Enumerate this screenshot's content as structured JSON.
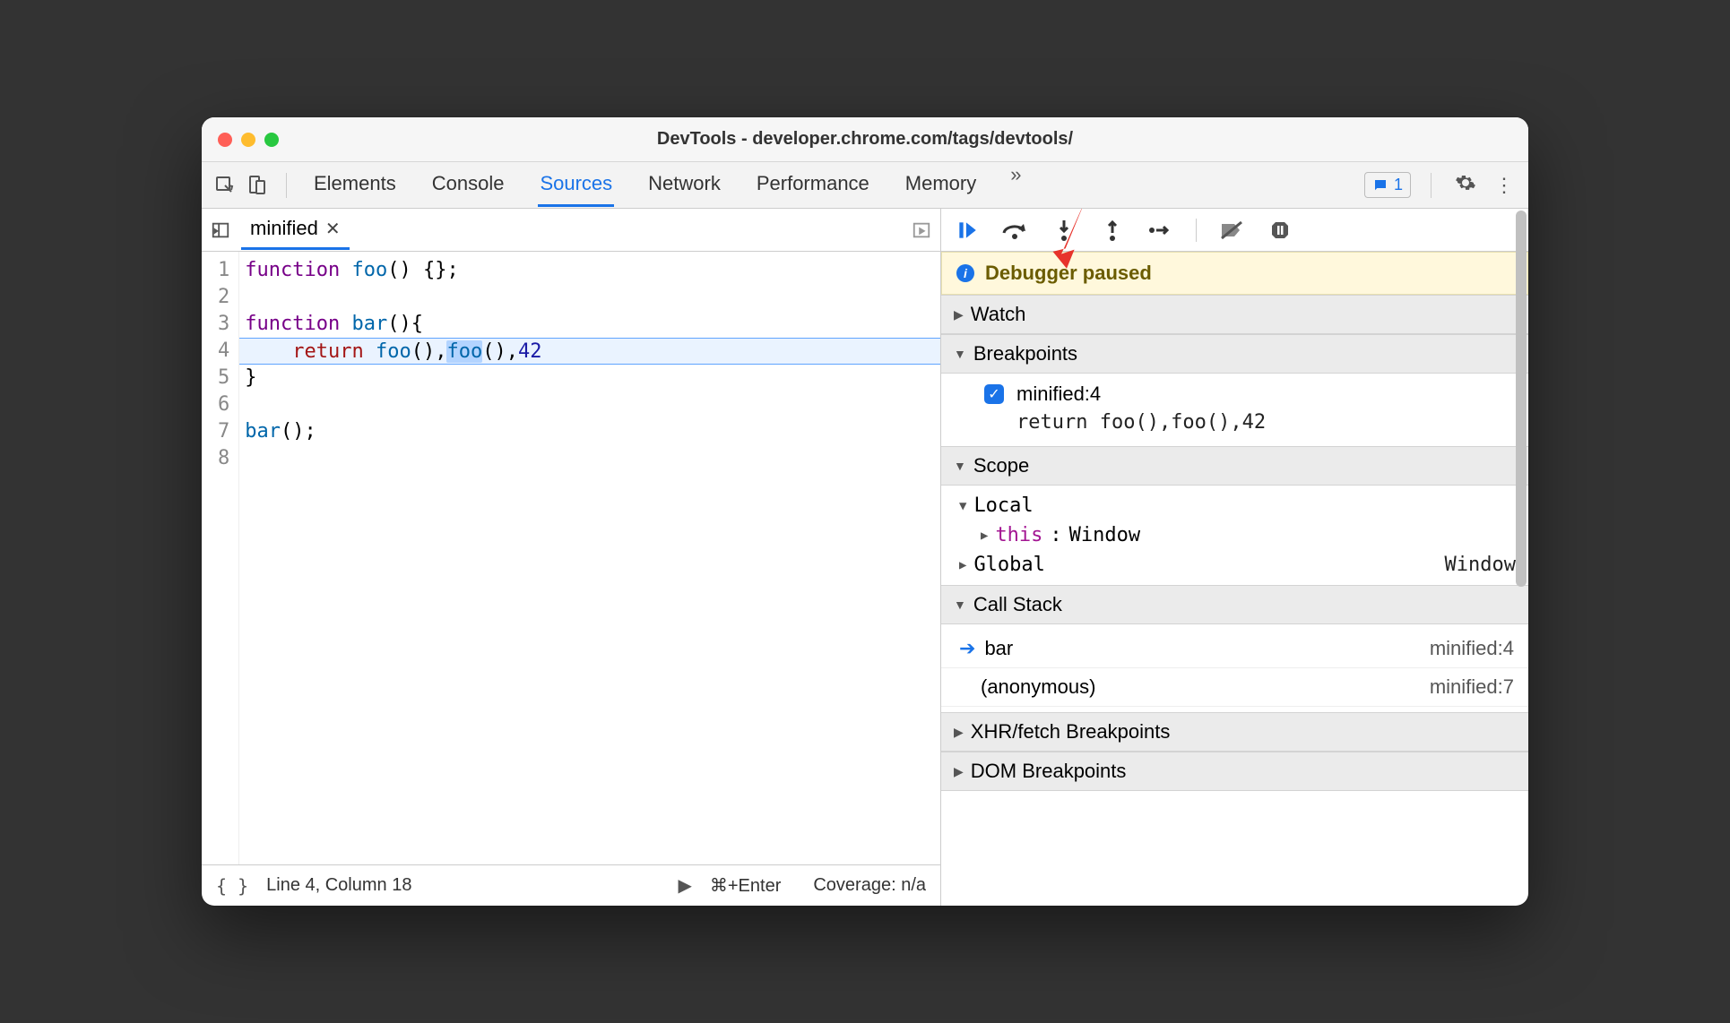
{
  "window": {
    "title": "DevTools - developer.chrome.com/tags/devtools/"
  },
  "messages": {
    "count": "1"
  },
  "tabs": {
    "items": [
      "Elements",
      "Console",
      "Sources",
      "Network",
      "Performance",
      "Memory"
    ],
    "active_index": 2
  },
  "file_tab": {
    "name": "minified"
  },
  "editor": {
    "lines": [
      "function foo() {};",
      "",
      "function bar(){",
      "    return foo(),foo(),42",
      "}",
      "",
      "bar();",
      ""
    ],
    "highlighted_line": 4,
    "selected_token": "foo",
    "cursor": {
      "line": 4,
      "column": 18
    }
  },
  "statusbar": {
    "pos": "Line 4, Column 18",
    "run_hint": "⌘+Enter",
    "coverage": "Coverage: n/a"
  },
  "debugger": {
    "banner": "Debugger paused",
    "sections": {
      "watch": "Watch",
      "breakpoints": "Breakpoints",
      "scope": "Scope",
      "callstack": "Call Stack",
      "xhr": "XHR/fetch Breakpoints",
      "dom": "DOM Breakpoints"
    },
    "breakpoint": {
      "label": "minified:4",
      "code": "return foo(),foo(),42"
    },
    "scope": {
      "local": "Local",
      "this_label": "this",
      "this_value": "Window",
      "global": "Global",
      "global_value": "Window"
    },
    "callstack": [
      {
        "fn": "bar",
        "loc": "minified:4",
        "active": true
      },
      {
        "fn": "(anonymous)",
        "loc": "minified:7",
        "active": false
      }
    ]
  },
  "icons": {
    "select": "select-element-icon",
    "device": "device-toolbar-icon",
    "overflow": "»"
  }
}
